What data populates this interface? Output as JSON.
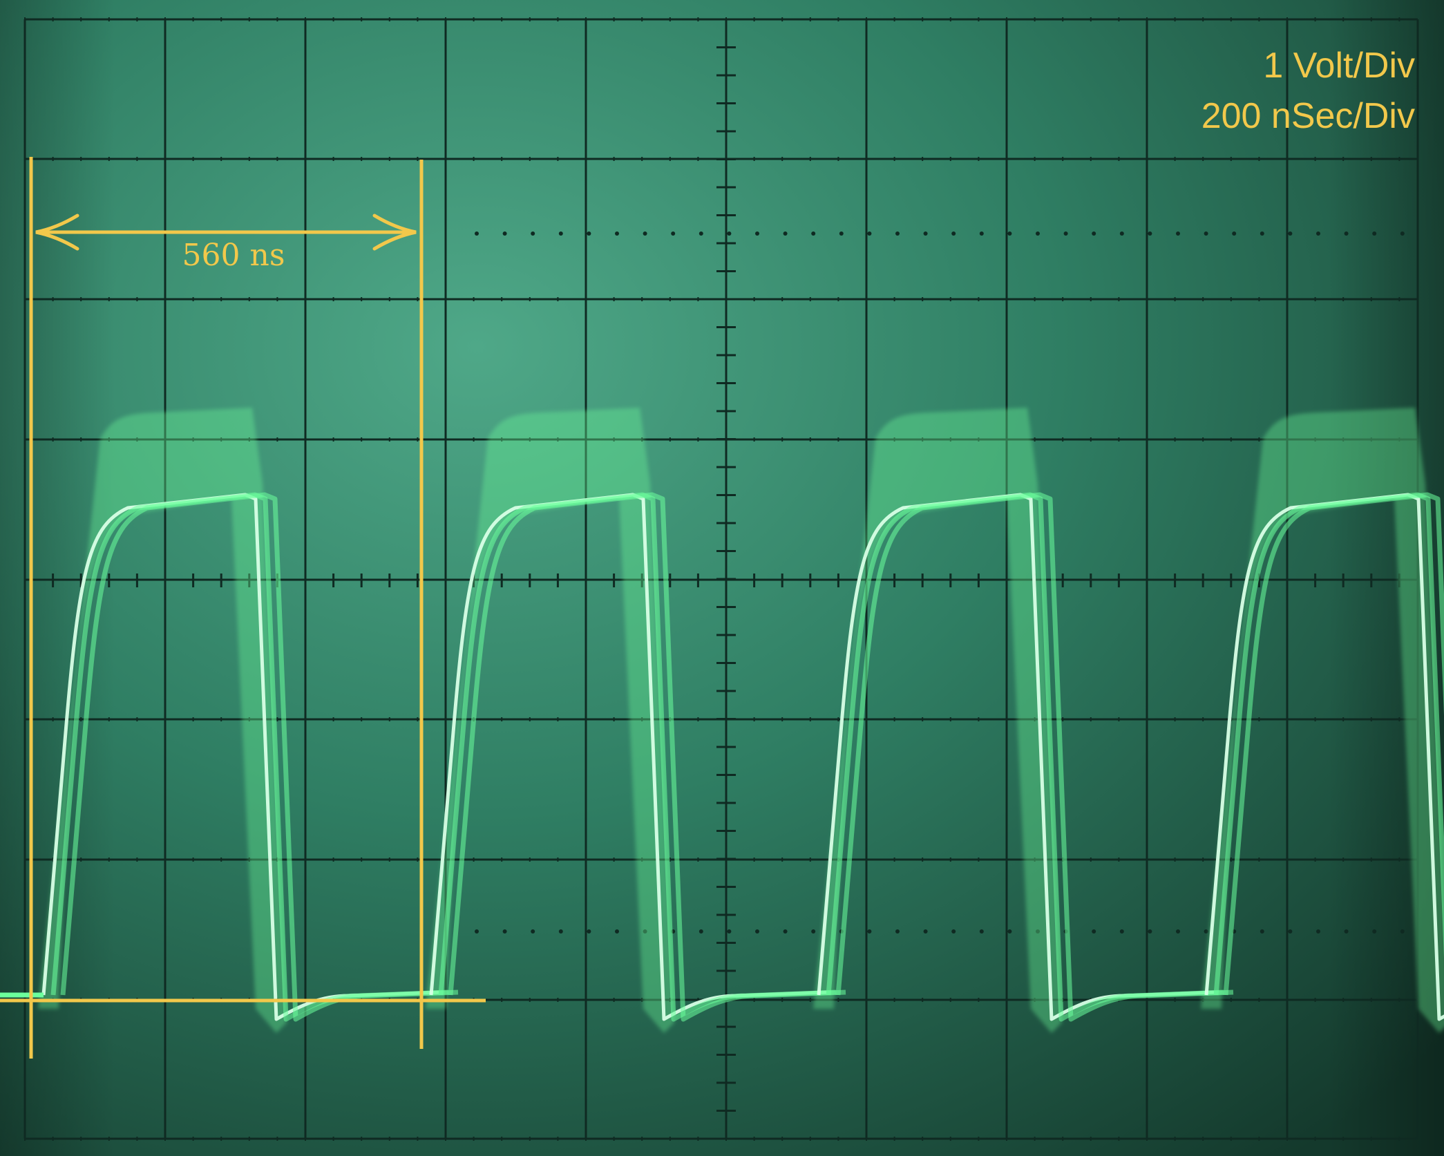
{
  "scale": {
    "volts_per_div": "1 Volt/Div",
    "time_per_div": "200 nSec/Div"
  },
  "measurement": {
    "period_label": "560 ns"
  },
  "colors": {
    "screen_light": "#4aa684",
    "screen_dark": "#153e30",
    "graticule": "#0f2a22",
    "trace": "#6cff9c",
    "annotation": "#f2c84b"
  }
}
